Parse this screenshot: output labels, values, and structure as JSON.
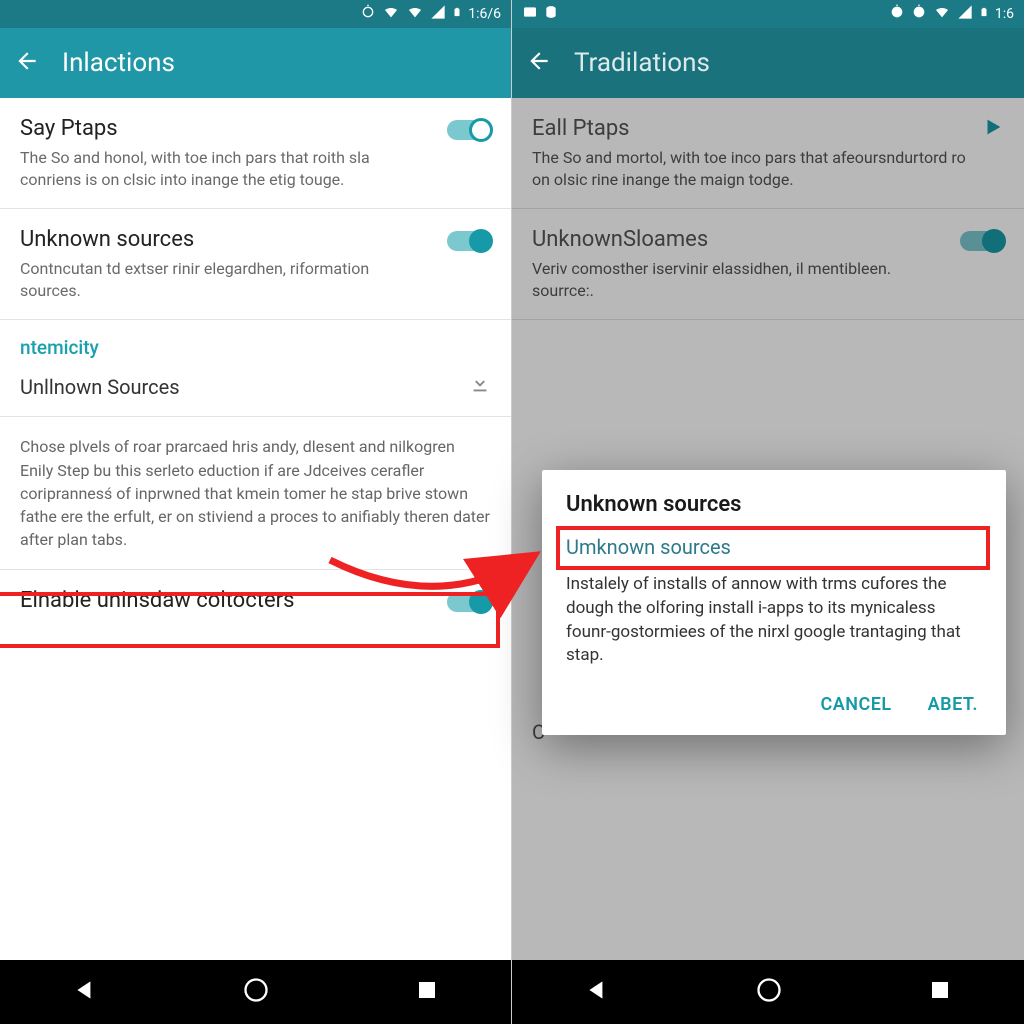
{
  "left": {
    "status_time": "1:6/6",
    "appbar_title": "Inlactions",
    "items": [
      {
        "title": "Say Ptaps",
        "desc": "The So and honol, with toe inch pars that roith sla conriens is on clsic into inange the etig touge.",
        "toggle": true,
        "hollow": true
      },
      {
        "title": "Unknown sources",
        "desc": "Contncutan td extser rinir elegardhen, riformation sources.",
        "toggle": true,
        "hollow": false
      }
    ],
    "section_label": "ntemicity",
    "sub_item": "Unllnown Sources",
    "paragraph": "Chose plvels of roar prarcaed hris andy, dlesent and nilkogren Enily Step bu this serleto eduction if are Jdceives cerafler coriprannesś of inprwned that kmein tomer he stap brive stown fathe ere the erfult, er on stiviend a proces to anifiably theren dater after plan tabs.",
    "last": {
      "title": "Elnable uninsdaw coltocters",
      "toggle": true
    }
  },
  "right": {
    "status_time": "1:6",
    "appbar_title": "Tradilations",
    "items": [
      {
        "title": "Eall Ptaps",
        "desc": "The So and mortol, with toe inco pars that afeoursndurtord ro on olsic rine inange the maign todge."
      },
      {
        "title": "UnknownSloames",
        "desc": "Veriv comosther iservinir elassidhen, il mentibleen. sourrce:."
      }
    ],
    "dialog": {
      "title": "Unknown sources",
      "sub": "Umknown sources",
      "body": "Instalely of installs of annow with trms cufores the dough the olforing install i-apps to its mynicaless founr-gostormiees of the nirxl google trantaging that stap.",
      "cancel": "CANCEL",
      "ok": "ABET."
    },
    "footer_char": "C"
  }
}
